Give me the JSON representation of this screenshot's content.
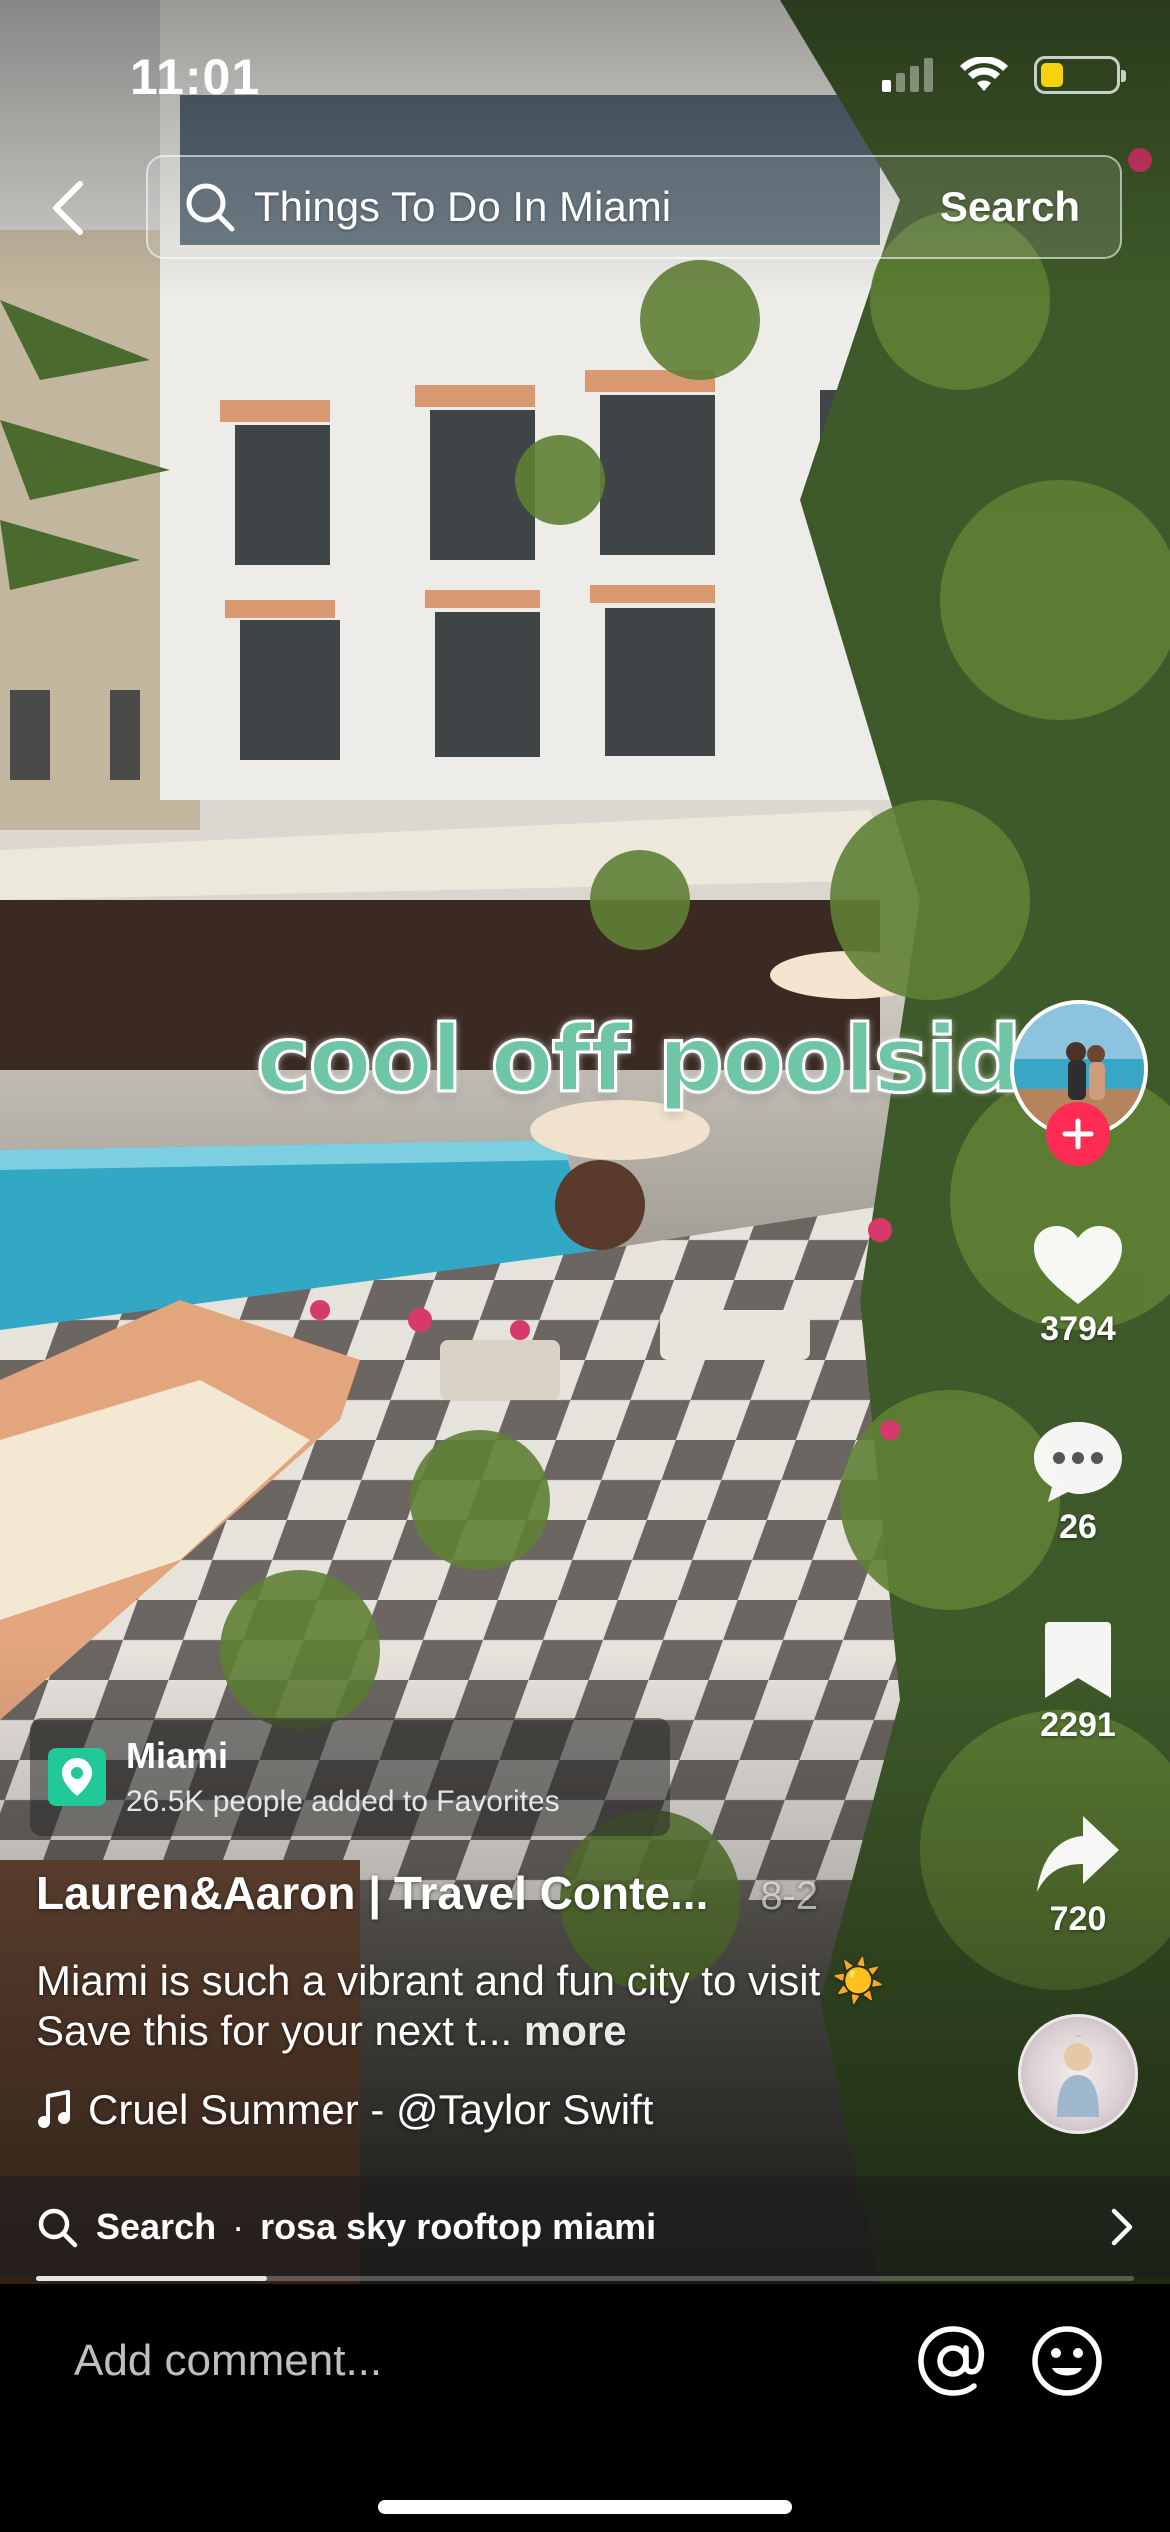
{
  "status_bar": {
    "time": "11:01",
    "battery_level": 0.3
  },
  "header": {
    "search_query": "Things To Do In Miami",
    "search_button": "Search"
  },
  "video": {
    "overlay_caption": "cool off poolside",
    "playback_progress": 0.21
  },
  "actions": {
    "likes": "3794",
    "comments": "26",
    "saves": "2291",
    "shares": "720"
  },
  "location": {
    "name": "Miami",
    "subtitle": "26.5K people added to Favorites"
  },
  "post": {
    "author": "Lauren&Aaron | Travel Conte...",
    "date": "8-2",
    "description": "Miami is such a vibrant and fun city to visit ☀️  Save this for your next t...",
    "more_label": "more",
    "sound": "Cruel Summer - @Taylor Swift"
  },
  "related_search": {
    "label": "Search",
    "term": "rosa sky rooftop miami"
  },
  "comment_bar": {
    "placeholder": "Add comment..."
  },
  "colors": {
    "accent_red": "#fe2c55",
    "location_green": "#20c997",
    "battery_yellow": "#f5d20b",
    "overlay_text": "#6fc6a6"
  }
}
